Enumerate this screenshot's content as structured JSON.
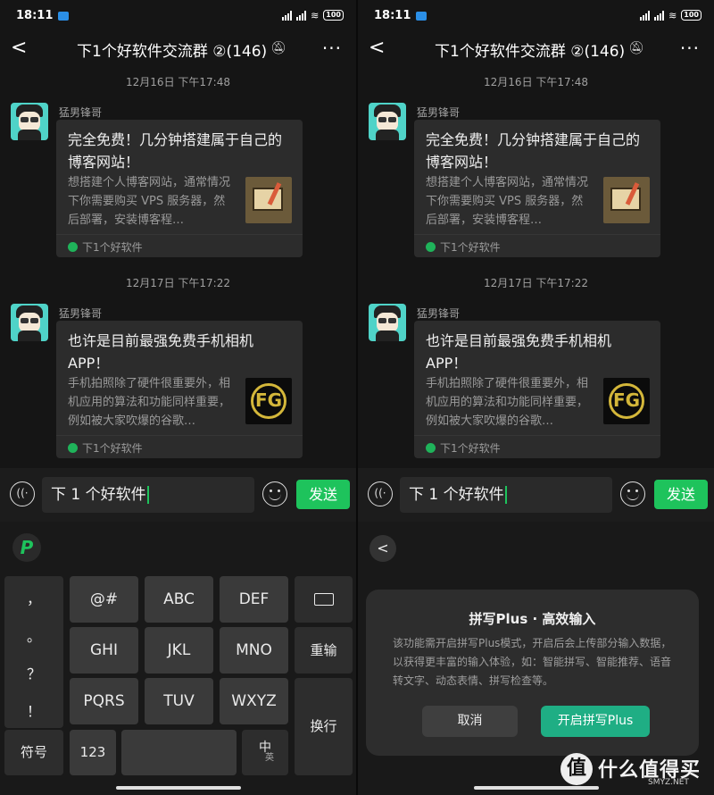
{
  "status": {
    "time": "18:11",
    "battery": "100"
  },
  "header": {
    "back": "<",
    "title": "下1个好软件交流群 ②(146)",
    "mute_icon": "bell-muted-icon",
    "more": "···"
  },
  "messages": [
    {
      "timestamp": "12月16日 下午17:48",
      "sender": "猛男锋哥",
      "title": "完全免费！几分钟搭建属于自己的博客网站！",
      "desc": "想搭建个人博客网站，通常情况下你需要购买 VPS 服务器，然后部署，安装博客程…",
      "source": "下1个好软件"
    },
    {
      "timestamp": "12月17日 下午17:22",
      "sender": "猛男锋哥",
      "title": "也许是目前最强免费手机相机APP！",
      "desc": "手机拍照除了硬件很重要外，相机应用的算法和功能同样重要，例如被大家吹爆的谷歌…",
      "source": "下1个好软件"
    }
  ],
  "thumb_letters": "FG",
  "input": {
    "value": "下 1 个好软件",
    "send_label": "发送",
    "voice_label": "((·"
  },
  "keyboard": {
    "logo": "P",
    "punctuation": [
      "，",
      "。",
      "？",
      "！"
    ],
    "row1": [
      "@#",
      "ABC",
      "DEF"
    ],
    "row2": [
      "GHI",
      "JKL",
      "MNO"
    ],
    "row3": [
      "PQRS",
      "TUV",
      "WXYZ"
    ],
    "reenter": "重输",
    "newline": "换行",
    "symbols": "符号",
    "numbers": "123",
    "lang_main": "中",
    "lang_sub": "英"
  },
  "dialog": {
    "back": "<",
    "title": "拼写Plus · 高效输入",
    "body": "该功能需开启拼写Plus模式，开启后会上传部分输入数据，以获得更丰富的输入体验，如：智能拼写、智能推荐、语音转文字、动态表情、拼写检查等。",
    "cancel": "取消",
    "confirm": "开启拼写Plus"
  },
  "watermark": {
    "logo": "值",
    "text": "什么值得买",
    "sub": "SMYZ.NET"
  },
  "colors": {
    "accent": "#1ec35c",
    "dialog_ok": "#1fae84",
    "card": "#2c2c2c",
    "background": "#151515"
  }
}
